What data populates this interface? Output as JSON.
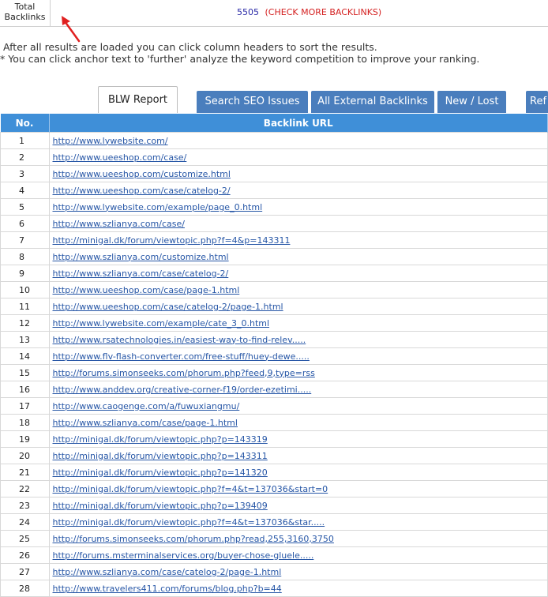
{
  "summary": {
    "total_label_line1": "Total",
    "total_label_line2": "Backlinks",
    "total_value": "5505",
    "check_more": "(CHECK MORE BACKLINKS)"
  },
  "info": {
    "line1": "After all results are loaded you can click column headers to sort the results.",
    "line2": "* You can click anchor text to 'further' analyze the keyword competition to improve your ranking."
  },
  "tabs": [
    {
      "label": "BLW Report",
      "active": true
    },
    {
      "label": "Search SEO Issues",
      "active": false
    },
    {
      "label": "All External Backlinks",
      "active": false
    },
    {
      "label": "New / Lost",
      "active": false
    },
    {
      "label": "Ref",
      "active": false
    }
  ],
  "table": {
    "headers": {
      "no": "No.",
      "url": "Backlink URL"
    },
    "rows": [
      {
        "no": "1",
        "url": "http://www.lywebsite.com/"
      },
      {
        "no": "2",
        "url": "http://www.ueeshop.com/case/"
      },
      {
        "no": "3",
        "url": "http://www.ueeshop.com/customize.html"
      },
      {
        "no": "4",
        "url": "http://www.ueeshop.com/case/catelog-2/"
      },
      {
        "no": "5",
        "url": "http://www.lywebsite.com/example/page_0.html"
      },
      {
        "no": "6",
        "url": "http://www.szlianya.com/case/"
      },
      {
        "no": "7",
        "url": "http://minigal.dk/forum/viewtopic.php?f=4&p=143311"
      },
      {
        "no": "8",
        "url": "http://www.szlianya.com/customize.html"
      },
      {
        "no": "9",
        "url": "http://www.szlianya.com/case/catelog-2/"
      },
      {
        "no": "10",
        "url": "http://www.ueeshop.com/case/page-1.html"
      },
      {
        "no": "11",
        "url": "http://www.ueeshop.com/case/catelog-2/page-1.html"
      },
      {
        "no": "12",
        "url": "http://www.lywebsite.com/example/cate_3_0.html"
      },
      {
        "no": "13",
        "url": "http://www.rsatechnologies.in/easiest-way-to-find-relev....."
      },
      {
        "no": "14",
        "url": "http://www.flv-flash-converter.com/free-stuff/huey-dewe....."
      },
      {
        "no": "15",
        "url": "http://forums.simonseeks.com/phorum.php?feed,9,type=rss"
      },
      {
        "no": "16",
        "url": "http://www.anddev.org/creative-corner-f19/order-ezetimi....."
      },
      {
        "no": "17",
        "url": "http://www.caogenge.com/a/fuwuxiangmu/"
      },
      {
        "no": "18",
        "url": "http://www.szlianya.com/case/page-1.html"
      },
      {
        "no": "19",
        "url": "http://minigal.dk/forum/viewtopic.php?p=143319"
      },
      {
        "no": "20",
        "url": "http://minigal.dk/forum/viewtopic.php?p=143311"
      },
      {
        "no": "21",
        "url": "http://minigal.dk/forum/viewtopic.php?p=141320"
      },
      {
        "no": "22",
        "url": "http://minigal.dk/forum/viewtopic.php?f=4&t=137036&start=0"
      },
      {
        "no": "23",
        "url": "http://minigal.dk/forum/viewtopic.php?p=139409"
      },
      {
        "no": "24",
        "url": "http://minigal.dk/forum/viewtopic.php?f=4&t=137036&star....."
      },
      {
        "no": "25",
        "url": "http://forums.simonseeks.com/phorum.php?read,255,3160,3750"
      },
      {
        "no": "26",
        "url": "http://forums.msterminalservices.org/buyer-chose-gluele....."
      },
      {
        "no": "27",
        "url": "http://www.szlianya.com/case/catelog-2/page-1.html"
      },
      {
        "no": "28",
        "url": "http://www.travelers411.com/forums/blog.php?b=44"
      }
    ]
  }
}
